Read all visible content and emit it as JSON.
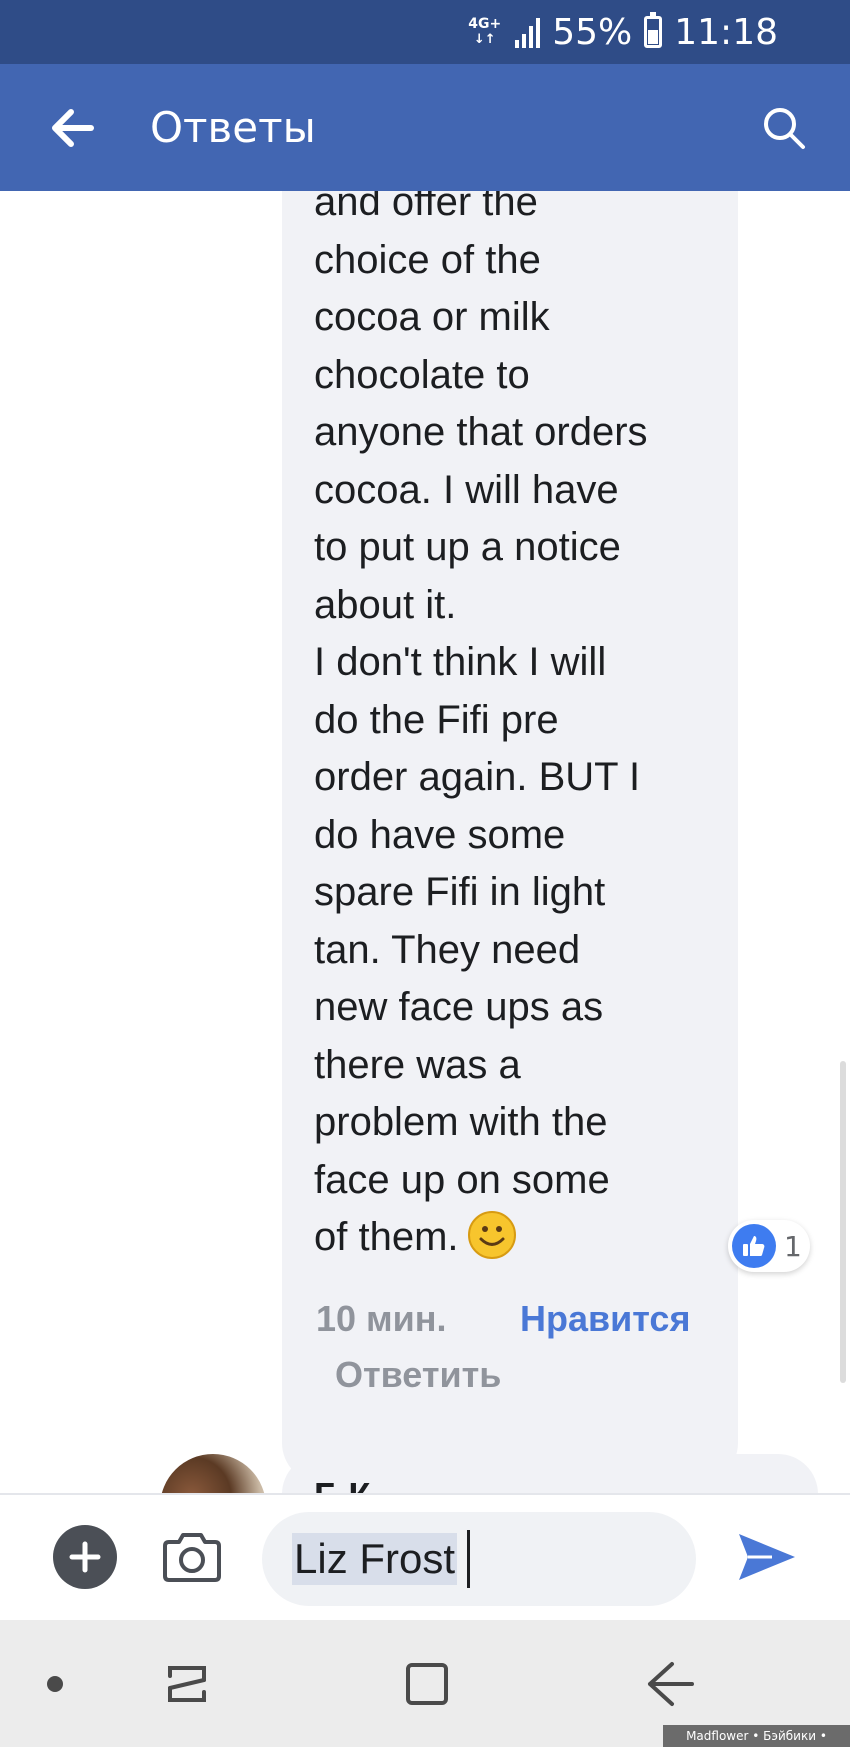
{
  "status_bar": {
    "network": "4G+",
    "network_arrows": "↓↑",
    "signal_icon": "signal-bars-icon",
    "battery_percent": "55%",
    "battery_icon": "battery-icon",
    "time": "11:18"
  },
  "app_bar": {
    "back_icon": "arrow-left-icon",
    "title": "Ответы",
    "search_icon": "search-icon"
  },
  "comment": {
    "text": "and offer the\nchoice of the\ncocoa or milk\nchocolate to\nanyone that orders\ncocoa. I will have\nto put up a notice\nabout it.\nI don't think I will\ndo the Fifi pre\norder again. BUT I\ndo have some\nspare Fifi in light\ntan. They need\nnew face ups as\nthere was a\nproblem with  the\nface up on some\nof them.",
    "emoji_icon": "smiling-face-icon",
    "like_icon": "thumbs-up-icon",
    "like_count": "1",
    "time": "10 мин.",
    "like_label": "Нравится",
    "reply_label": "Ответить"
  },
  "next_comment": {
    "name_partial": "Г         К"
  },
  "composer": {
    "add_icon": "plus-circle-icon",
    "camera_icon": "camera-icon",
    "input_value": "Liz Frost",
    "send_icon": "send-icon"
  },
  "nav_bar": {
    "dot_icon": "dot-icon",
    "recent_icon": "recent-apps-icon",
    "home_icon": "home-icon",
    "back_icon": "back-icon"
  },
  "watermark": "Madflower • Бэйбики • babiki.ru",
  "colors": {
    "status_bar": "#2f4c87",
    "app_bar": "#4266b2",
    "bubble": "#f1f2f6",
    "accent": "#4a78d6",
    "like_blue": "#3e7cf0"
  }
}
